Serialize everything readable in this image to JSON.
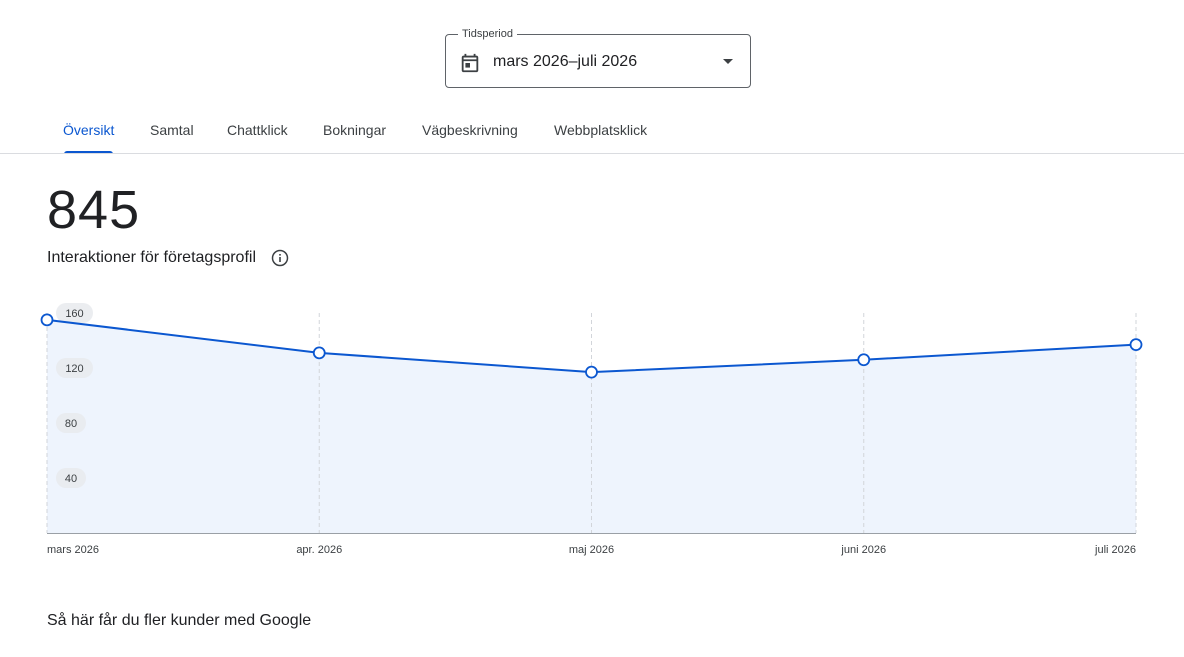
{
  "period": {
    "label": "Tidsperiod",
    "value": "mars 2026–juli 2026",
    "icon": "calendar-icon"
  },
  "tabs": [
    {
      "label": "Översikt",
      "active": true
    },
    {
      "label": "Samtal",
      "active": false
    },
    {
      "label": "Chattklick",
      "active": false
    },
    {
      "label": "Bokningar",
      "active": false
    },
    {
      "label": "Vägbeskrivning",
      "active": false
    },
    {
      "label": "Webbplatsklick",
      "active": false
    }
  ],
  "metric": {
    "value": "845",
    "label": "Interaktioner för företagsprofil",
    "info_icon": "info-icon"
  },
  "chart_data": {
    "type": "area",
    "categories": [
      "mars 2026",
      "apr. 2026",
      "maj 2026",
      "juni 2026",
      "juli 2026"
    ],
    "values": [
      155,
      131,
      117,
      126,
      137
    ],
    "ylim": [
      0,
      160
    ],
    "yticks": [
      "160",
      "120",
      "80",
      "40"
    ],
    "grid": "vertical-dashed",
    "line_color": "#0b57d0",
    "fill_color": "#eef4fd"
  },
  "cta": {
    "heading": "Så här får du fler kunder med Google"
  },
  "colors": {
    "accent": "#0b57d0",
    "text": "#202124",
    "divider": "#dadce0"
  }
}
